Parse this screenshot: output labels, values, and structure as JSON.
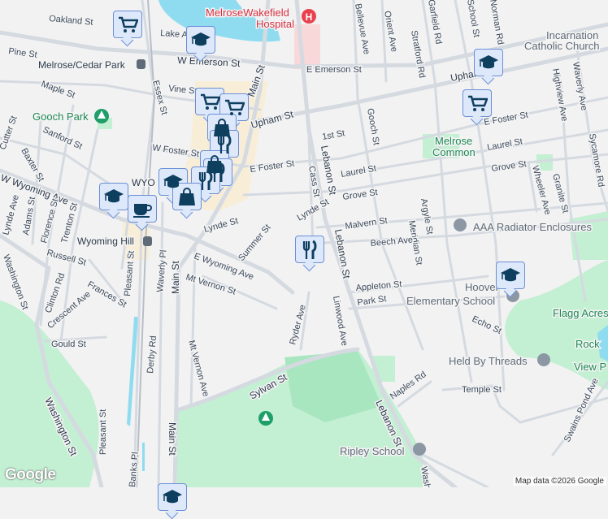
{
  "map": {
    "labels": [
      "Oakland St",
      "Lake Ave",
      "Pine St",
      "Melrose/Cedar Park",
      "W Emerson St",
      "E Emerson St",
      "Maple St",
      "Vine St",
      "Essex St",
      "Main St",
      "Gooch Park",
      "Upham St",
      "Sanford St",
      "Cutter St",
      "Baxter St",
      "W Foster St",
      "E Foster St",
      "WYO",
      "W Wyoming Ave",
      "Lynde Ave",
      "Adams St",
      "Florence St",
      "Trenton St",
      "Wyoming Hill",
      "Lynde St",
      "Summer St",
      "E Wyoming Ave",
      "Russell St",
      "Mt Vernon St",
      "Frances St",
      "Clinton Rd",
      "Washington St",
      "Pleasant St",
      "Waverly Pl",
      "Main St",
      "Crescent Ave",
      "Gould St",
      "Derby Rd",
      "Mt Vernon Ave",
      "Ryder Ave",
      "Sylvan St",
      "Washington St",
      "Pleasant St",
      "Main St",
      "Banks Pl",
      "MelroseWakefield",
      "Hospital",
      "Bellevue Ave",
      "Orient Ave",
      "Stratford Rd",
      "Garfield Rd",
      "School St",
      "Norman Rd",
      "Upham St",
      "Incarnation",
      "Catholic Church",
      "Highview Ave",
      "Waverly Ave",
      "1st St",
      "Gooch St",
      "E Foster St",
      "Laurel St",
      "Melrose",
      "Common",
      "Lebanon St",
      "Cass St",
      "Laurel St",
      "Grove St",
      "Grove St",
      "Wheeler Ave",
      "Granite St",
      "Sycamore Rd",
      "Lynde St",
      "Malvern St",
      "Meridian St",
      "Argyle St",
      "AAA Radiator Enclosures",
      "Beech Ave",
      "Lebanon St",
      "Appleton St",
      "Park St",
      "Hoover",
      "Elementary School",
      "Linwood Ave",
      "Echo St",
      "Flagg Acres",
      "Held By Threads",
      "Rock",
      "View P",
      "Naples Rd",
      "Temple St",
      "Swains Pond Ave",
      "Lebanon St",
      "Ripley School",
      "Washington St",
      "E Emerson St"
    ],
    "markers": [
      {
        "type": "shopping-cart"
      },
      {
        "type": "school"
      },
      {
        "type": "school"
      },
      {
        "type": "shopping-cart"
      },
      {
        "type": "shopping-cart"
      },
      {
        "type": "shopping-cart"
      },
      {
        "type": "shopping-bag"
      },
      {
        "type": "restaurant"
      },
      {
        "type": "shopping-bag"
      },
      {
        "type": "restaurant"
      },
      {
        "type": "restaurant"
      },
      {
        "type": "school"
      },
      {
        "type": "shopping-bag"
      },
      {
        "type": "school"
      },
      {
        "type": "coffee"
      },
      {
        "type": "restaurant"
      },
      {
        "type": "school"
      },
      {
        "type": "school"
      }
    ],
    "attribution": "Map data ©2026 Google",
    "logo": "Google",
    "colors": {
      "background": "#f2f2f2",
      "road": "#d5dae1",
      "park": "#c3efd2",
      "water": "#8fdcf0",
      "downtown": "#f8eed8",
      "marker_fill": "#dde8fb",
      "marker_border": "#6b8fd6",
      "icon": "#0f3f5f"
    }
  }
}
